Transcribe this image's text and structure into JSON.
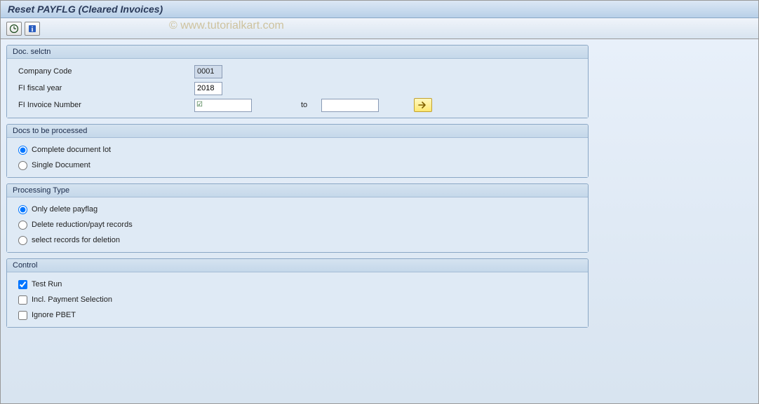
{
  "titlebar": {
    "title": "Reset PAYFLG (Cleared Invoices)"
  },
  "watermark": "© www.tutorialkart.com",
  "groups": {
    "doc_selctn": {
      "title": "Doc. selctn",
      "fields": {
        "company_code": {
          "label": "Company Code",
          "value": "0001"
        },
        "fi_fiscal_year": {
          "label": "FI fiscal year",
          "value": "2018"
        },
        "fi_invoice_number": {
          "label": "FI Invoice Number",
          "from": "",
          "to_label": "to",
          "to": ""
        }
      }
    },
    "docs_processed": {
      "title": "Docs to be processed",
      "options": {
        "complete": "Complete document lot",
        "single": "Single Document"
      }
    },
    "processing_type": {
      "title": "Processing Type",
      "options": {
        "only_delete": "Only delete payflag",
        "delete_reduction": "Delete reduction/payt records",
        "select_records": "select records for deletion"
      }
    },
    "control": {
      "title": "Control",
      "options": {
        "test_run": "Test Run",
        "incl_payment": "Incl. Payment Selection",
        "ignore_pbet": "Ignore PBET"
      }
    }
  }
}
